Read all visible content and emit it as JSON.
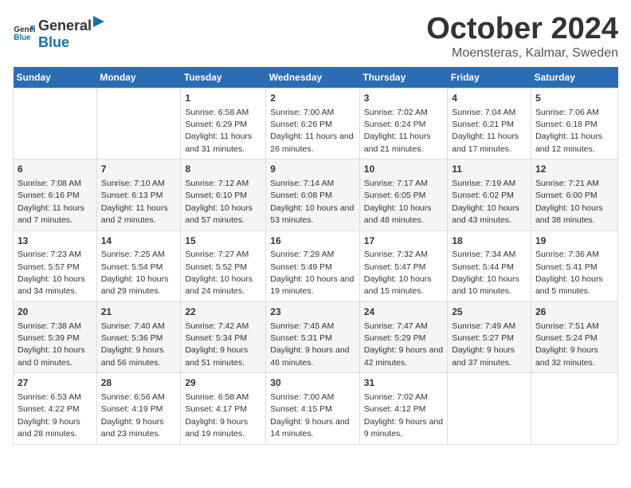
{
  "logo": {
    "general": "General",
    "blue": "Blue"
  },
  "title": "October 2024",
  "subtitle": "Moensteras, Kalmar, Sweden",
  "headers": [
    "Sunday",
    "Monday",
    "Tuesday",
    "Wednesday",
    "Thursday",
    "Friday",
    "Saturday"
  ],
  "weeks": [
    [
      {
        "day": "",
        "info": ""
      },
      {
        "day": "",
        "info": ""
      },
      {
        "day": "1",
        "info": "Sunrise: 6:58 AM\nSunset: 6:29 PM\nDaylight: 11 hours and 31 minutes."
      },
      {
        "day": "2",
        "info": "Sunrise: 7:00 AM\nSunset: 6:26 PM\nDaylight: 11 hours and 26 minutes."
      },
      {
        "day": "3",
        "info": "Sunrise: 7:02 AM\nSunset: 6:24 PM\nDaylight: 11 hours and 21 minutes."
      },
      {
        "day": "4",
        "info": "Sunrise: 7:04 AM\nSunset: 6:21 PM\nDaylight: 11 hours and 17 minutes."
      },
      {
        "day": "5",
        "info": "Sunrise: 7:06 AM\nSunset: 6:18 PM\nDaylight: 11 hours and 12 minutes."
      }
    ],
    [
      {
        "day": "6",
        "info": "Sunrise: 7:08 AM\nSunset: 6:16 PM\nDaylight: 11 hours and 7 minutes."
      },
      {
        "day": "7",
        "info": "Sunrise: 7:10 AM\nSunset: 6:13 PM\nDaylight: 11 hours and 2 minutes."
      },
      {
        "day": "8",
        "info": "Sunrise: 7:12 AM\nSunset: 6:10 PM\nDaylight: 10 hours and 57 minutes."
      },
      {
        "day": "9",
        "info": "Sunrise: 7:14 AM\nSunset: 6:08 PM\nDaylight: 10 hours and 53 minutes."
      },
      {
        "day": "10",
        "info": "Sunrise: 7:17 AM\nSunset: 6:05 PM\nDaylight: 10 hours and 48 minutes."
      },
      {
        "day": "11",
        "info": "Sunrise: 7:19 AM\nSunset: 6:02 PM\nDaylight: 10 hours and 43 minutes."
      },
      {
        "day": "12",
        "info": "Sunrise: 7:21 AM\nSunset: 6:00 PM\nDaylight: 10 hours and 38 minutes."
      }
    ],
    [
      {
        "day": "13",
        "info": "Sunrise: 7:23 AM\nSunset: 5:57 PM\nDaylight: 10 hours and 34 minutes."
      },
      {
        "day": "14",
        "info": "Sunrise: 7:25 AM\nSunset: 5:54 PM\nDaylight: 10 hours and 29 minutes."
      },
      {
        "day": "15",
        "info": "Sunrise: 7:27 AM\nSunset: 5:52 PM\nDaylight: 10 hours and 24 minutes."
      },
      {
        "day": "16",
        "info": "Sunrise: 7:29 AM\nSunset: 5:49 PM\nDaylight: 10 hours and 19 minutes."
      },
      {
        "day": "17",
        "info": "Sunrise: 7:32 AM\nSunset: 5:47 PM\nDaylight: 10 hours and 15 minutes."
      },
      {
        "day": "18",
        "info": "Sunrise: 7:34 AM\nSunset: 5:44 PM\nDaylight: 10 hours and 10 minutes."
      },
      {
        "day": "19",
        "info": "Sunrise: 7:36 AM\nSunset: 5:41 PM\nDaylight: 10 hours and 5 minutes."
      }
    ],
    [
      {
        "day": "20",
        "info": "Sunrise: 7:38 AM\nSunset: 5:39 PM\nDaylight: 10 hours and 0 minutes."
      },
      {
        "day": "21",
        "info": "Sunrise: 7:40 AM\nSunset: 5:36 PM\nDaylight: 9 hours and 56 minutes."
      },
      {
        "day": "22",
        "info": "Sunrise: 7:42 AM\nSunset: 5:34 PM\nDaylight: 9 hours and 51 minutes."
      },
      {
        "day": "23",
        "info": "Sunrise: 7:45 AM\nSunset: 5:31 PM\nDaylight: 9 hours and 46 minutes."
      },
      {
        "day": "24",
        "info": "Sunrise: 7:47 AM\nSunset: 5:29 PM\nDaylight: 9 hours and 42 minutes."
      },
      {
        "day": "25",
        "info": "Sunrise: 7:49 AM\nSunset: 5:27 PM\nDaylight: 9 hours and 37 minutes."
      },
      {
        "day": "26",
        "info": "Sunrise: 7:51 AM\nSunset: 5:24 PM\nDaylight: 9 hours and 32 minutes."
      }
    ],
    [
      {
        "day": "27",
        "info": "Sunrise: 6:53 AM\nSunset: 4:22 PM\nDaylight: 9 hours and 28 minutes."
      },
      {
        "day": "28",
        "info": "Sunrise: 6:56 AM\nSunset: 4:19 PM\nDaylight: 9 hours and 23 minutes."
      },
      {
        "day": "29",
        "info": "Sunrise: 6:58 AM\nSunset: 4:17 PM\nDaylight: 9 hours and 19 minutes."
      },
      {
        "day": "30",
        "info": "Sunrise: 7:00 AM\nSunset: 4:15 PM\nDaylight: 9 hours and 14 minutes."
      },
      {
        "day": "31",
        "info": "Sunrise: 7:02 AM\nSunset: 4:12 PM\nDaylight: 9 hours and 9 minutes."
      },
      {
        "day": "",
        "info": ""
      },
      {
        "day": "",
        "info": ""
      }
    ]
  ]
}
